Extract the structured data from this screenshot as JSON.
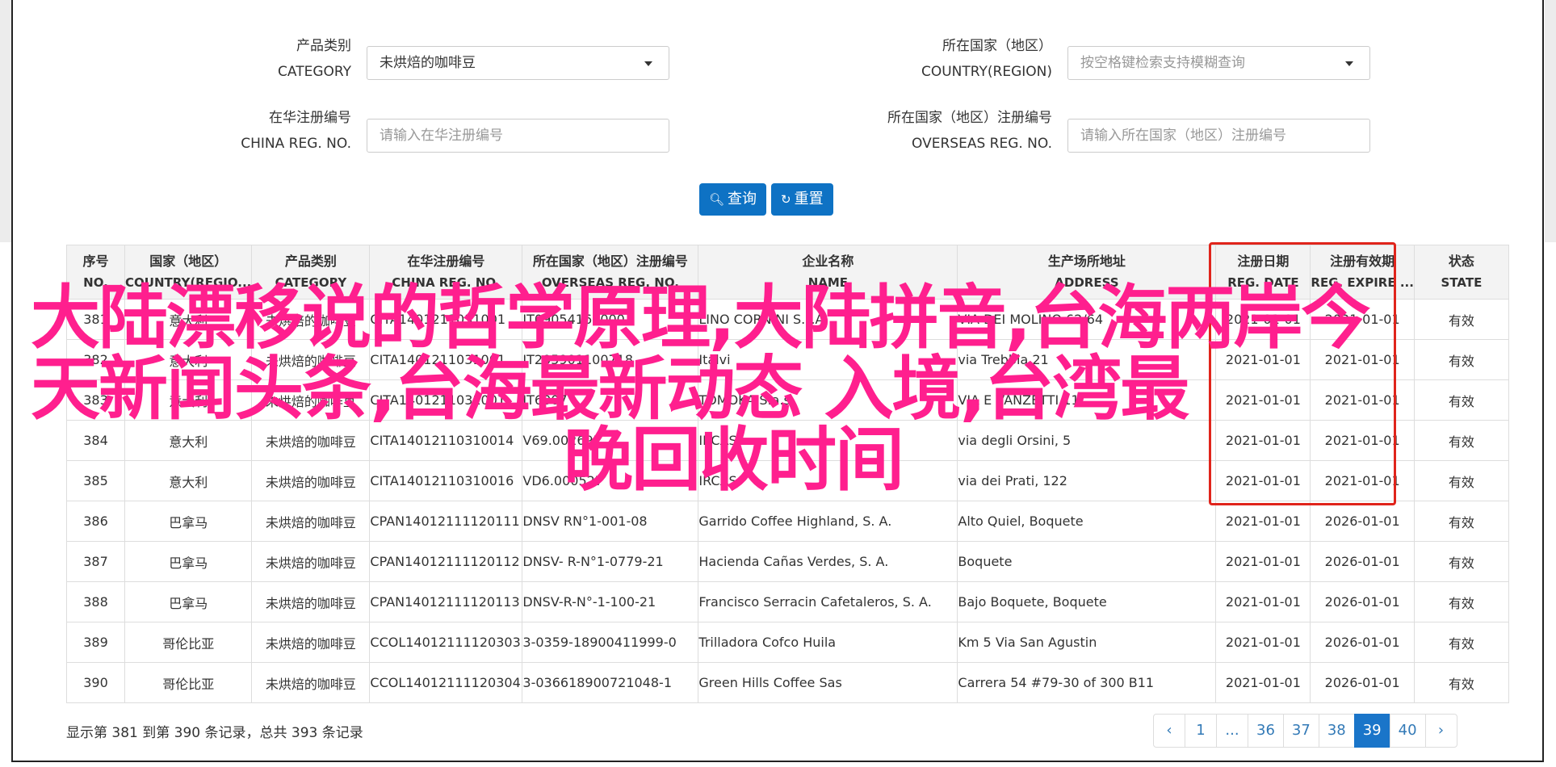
{
  "filters": {
    "category": {
      "label_cn": "产品类别",
      "label_en": "CATEGORY",
      "value": "未烘焙的咖啡豆"
    },
    "country": {
      "label_cn": "所在国家（地区）",
      "label_en": "COUNTRY(REGION)",
      "placeholder": "按空格键检索支持模糊查询"
    },
    "china_reg": {
      "label_cn": "在华注册编号",
      "label_en": "CHINA REG. NO.",
      "placeholder": "请输入在华注册编号"
    },
    "overseas_reg": {
      "label_cn": "所在国家（地区）注册编号",
      "label_en": "OVERSEAS REG. NO.",
      "placeholder": "请输入所在国家（地区）注册编号"
    },
    "search_label": "查询",
    "reset_label": "重置"
  },
  "table": {
    "headers": [
      {
        "cn": "序号",
        "en": "NO."
      },
      {
        "cn": "国家（地区）",
        "en": "COUNTRY(REGIO..."
      },
      {
        "cn": "产品类别",
        "en": "CATEGORY"
      },
      {
        "cn": "在华注册编号",
        "en": "CHINA REG. NO."
      },
      {
        "cn": "所在国家（地区）注册编号",
        "en": "OVERSEAS REG. NO."
      },
      {
        "cn": "企业名称",
        "en": "NAME"
      },
      {
        "cn": "生产场所地址",
        "en": "ADDRESS"
      },
      {
        "cn": "注册日期",
        "en": "REG. DATE"
      },
      {
        "cn": "注册有效期",
        "en": "REG. EXPIRE ..."
      },
      {
        "cn": "状态",
        "en": "STATE"
      }
    ],
    "rows": [
      {
        "no": "381",
        "country": "意大利",
        "category": "未烘焙的咖啡豆",
        "china_reg": "CITA1401211031001",
        "overseas_reg": "IT09054160000",
        "name": "LINO CORNINI S.P.A.",
        "address": "VIA DEI MOLINO 62/64",
        "reg_date": "2021-01-01",
        "expire": "2021-01-01",
        "state": "有效"
      },
      {
        "no": "382",
        "country": "意大利",
        "category": "未烘焙的咖啡豆",
        "china_reg": "CITA1401211031001",
        "overseas_reg": "IT205901100718",
        "name": "Italvi",
        "address": "via Trebbia 21",
        "reg_date": "2021-01-01",
        "expire": "2021-01-01",
        "state": "有效"
      },
      {
        "no": "383",
        "country": "意大利",
        "category": "未烘焙的咖啡豆",
        "china_reg": "CITA1401211031001",
        "overseas_reg": "IT6007",
        "name": "TOMOKA S.a.s",
        "address": "VIA E VANZETTI 11",
        "reg_date": "2021-01-01",
        "expire": "2021-01-01",
        "state": "有效"
      },
      {
        "no": "384",
        "country": "意大利",
        "category": "未烘焙的咖啡豆",
        "china_reg": "CITA14012110310014",
        "overseas_reg": "V69.002697",
        "name": "IRCAS",
        "address": "via degli Orsini, 5",
        "reg_date": "2021-01-01",
        "expire": "2021-01-01",
        "state": "有效"
      },
      {
        "no": "385",
        "country": "意大利",
        "category": "未烘焙的咖啡豆",
        "china_reg": "CITA14012110310016",
        "overseas_reg": "VD6.000527",
        "name": "IRCAS",
        "address": "via dei Prati, 122",
        "reg_date": "2021-01-01",
        "expire": "2021-01-01",
        "state": "有效"
      },
      {
        "no": "386",
        "country": "巴拿马",
        "category": "未烘焙的咖啡豆",
        "china_reg": "CPAN14012111120111",
        "overseas_reg": "DNSV RN°1-001-08",
        "name": "Garrido Coffee Highland, S. A.",
        "address": "Alto Quiel, Boquete",
        "reg_date": "2021-01-01",
        "expire": "2026-01-01",
        "state": "有效"
      },
      {
        "no": "387",
        "country": "巴拿马",
        "category": "未烘焙的咖啡豆",
        "china_reg": "CPAN14012111120112",
        "overseas_reg": "DNSV- R-N°1-0779-21",
        "name": "Hacienda Cañas Verdes, S. A.",
        "address": "Boquete",
        "reg_date": "2021-01-01",
        "expire": "2026-01-01",
        "state": "有效"
      },
      {
        "no": "388",
        "country": "巴拿马",
        "category": "未烘焙的咖啡豆",
        "china_reg": "CPAN14012111120113",
        "overseas_reg": "DNSV-R-N°-1-100-21",
        "name": "Francisco Serracin Cafetaleros, S. A.",
        "address": "Bajo Boquete, Boquete",
        "reg_date": "2021-01-01",
        "expire": "2026-01-01",
        "state": "有效"
      },
      {
        "no": "389",
        "country": "哥伦比亚",
        "category": "未烘焙的咖啡豆",
        "china_reg": "CCOL14012111120303",
        "overseas_reg": "3-0359-18900411999-0",
        "name": "Trilladora Cofco Huila",
        "address": "Km 5 Via San Agustin",
        "reg_date": "2021-01-01",
        "expire": "2026-01-01",
        "state": "有效"
      },
      {
        "no": "390",
        "country": "哥伦比亚",
        "category": "未烘焙的咖啡豆",
        "china_reg": "CCOL14012111120304",
        "overseas_reg": "3-036618900721048-1",
        "name": "Green Hills Coffee Sas",
        "address": "Carrera 54 #79-30 of 300 B11",
        "reg_date": "2021-01-01",
        "expire": "2026-01-01",
        "state": "有效"
      }
    ]
  },
  "summary": "显示第 381 到第 390 条记录，总共 393 条记录",
  "pagination": {
    "prev": "‹",
    "pages": [
      "1",
      "...",
      "36",
      "37",
      "38",
      "39",
      "40"
    ],
    "active": "39",
    "next": "›"
  },
  "overlay": {
    "line1": "大陆漂移说的哲学原理,大陆拼音,台海两岸今",
    "line2": "天新闻头条,台海最新动态  入境,台湾最",
    "line3": "晚回收时间"
  },
  "colors": {
    "primary": "#0e72c4",
    "highlight_border": "#e0241b",
    "overlay_text": "#ff1f8e"
  },
  "icons": {
    "search": "search-icon",
    "refresh": "refresh-icon",
    "dropdown": "chevron-down-icon"
  }
}
